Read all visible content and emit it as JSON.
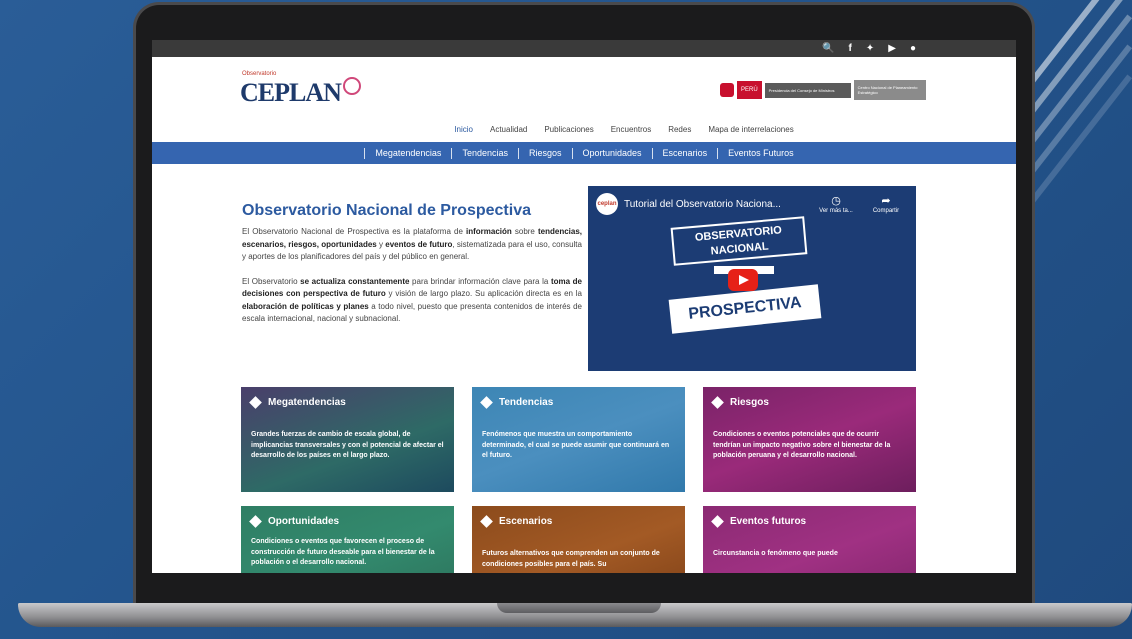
{
  "topbar": {
    "icons": [
      "search-icon",
      "facebook-icon",
      "twitter-icon",
      "youtube-icon",
      "user-icon"
    ]
  },
  "logo": {
    "small": "Observatorio",
    "big": "CEPLAN"
  },
  "gov": {
    "peru": "PERÚ",
    "presidencia": "Presidencia del Consejo de Ministros",
    "centro": "Centro Nacional de Planeamiento Estratégico"
  },
  "mainnav": [
    "Inicio",
    "Actualidad",
    "Publicaciones",
    "Encuentros",
    "Redes",
    "Mapa de interrelaciones"
  ],
  "bluenav": [
    "Megatendencias",
    "Tendencias",
    "Riesgos",
    "Oportunidades",
    "Escenarios",
    "Eventos Futuros"
  ],
  "intro": {
    "title": "Observatorio Nacional de Prospectiva",
    "p1_a": "El Observatorio Nacional de Prospectiva es la plataforma de ",
    "p1_b": "información",
    "p1_c": " sobre ",
    "p1_d": "tendencias, escenarios, riesgos, oportunidades",
    "p1_e": " y ",
    "p1_f": "eventos de futuro",
    "p1_g": ", sistematizada para el uso, consulta y aportes de los planificadores del país y del público en general.",
    "p2_a": "El Observatorio ",
    "p2_b": "se actualiza constantemente",
    "p2_c": " para brindar información clave para la ",
    "p2_d": "toma de decisiones con perspectiva de futuro",
    "p2_e": " y visión de largo plazo. Su aplicación directa es en la ",
    "p2_f": "elaboración de políticas y planes",
    "p2_g": " a todo nivel, puesto que presenta contenidos de interés de escala internacional, nacional y subnacional."
  },
  "video": {
    "channel": "ceplan",
    "title": "Tutorial del Observatorio Naciona...",
    "watch_later": "Ver más ta...",
    "share": "Compartir",
    "badge_line1": "OBSERVATORIO",
    "badge_line2": "NACIONAL",
    "big_word": "PROSPECTIVA"
  },
  "cards": [
    {
      "title": "Megatendencias",
      "desc": "Grandes fuerzas de cambio de escala global, de implicancias transversales y con el potencial de afectar el desarrollo de los países en el largo plazo."
    },
    {
      "title": "Tendencias",
      "desc": "Fenómenos que muestra un comportamiento determinado, el cual se puede asumir que continuará en el futuro."
    },
    {
      "title": "Riesgos",
      "desc": "Condiciones o eventos potenciales que de ocurrir tendrían un impacto negativo sobre el bienestar de la población peruana y el desarrollo nacional."
    },
    {
      "title": "Oportunidades",
      "desc": "Condiciones o eventos que favorecen el proceso de construcción de futuro deseable para el bienestar de la población o el desarrollo nacional."
    },
    {
      "title": "Escenarios",
      "desc": "Futuros alternativos que comprenden un conjunto de condiciones posibles para el país. Su"
    },
    {
      "title": "Eventos futuros",
      "desc": "Circunstancia o fenómeno que puede"
    }
  ]
}
